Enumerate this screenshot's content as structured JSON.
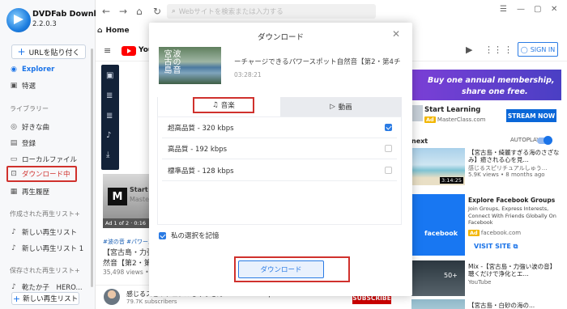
{
  "app": {
    "name": "DVDFab Downloader",
    "version": "2.2.0.3"
  },
  "sidebar": {
    "url_button": "URLを貼り付く",
    "items": [
      {
        "label": "Explorer",
        "icon": "compass-icon"
      },
      {
        "label": "特選",
        "icon": "star-icon"
      }
    ],
    "library_section": "ライブラリー",
    "library_items": [
      {
        "label": "好きな曲",
        "icon": "heart-icon"
      },
      {
        "label": "登録",
        "icon": "subscribe-icon"
      },
      {
        "label": "ローカルファイル",
        "icon": "folder-icon"
      },
      {
        "label": "ダウンロード中",
        "icon": "download-icon"
      },
      {
        "label": "再生履歴",
        "icon": "history-icon"
      }
    ],
    "created_section": "作成された再生リスト+",
    "created_items": [
      {
        "label": "新しい再生リスト"
      },
      {
        "label": "新しい再生リスト 1"
      }
    ],
    "saved_section": "保存された再生リスト+",
    "saved_items": [
      {
        "label": "乾たか子　HERO..."
      }
    ],
    "new_playlist": "新しい再生リスト"
  },
  "topbar": {
    "search_placeholder": "Webサイトを検索または入力する"
  },
  "home_tab": "Home",
  "youtube": {
    "logo_text": "YouTube",
    "sign_in": "SIGN IN"
  },
  "left_video": {
    "ad_title": "Start Le",
    "ad_sub": "MasterCl",
    "ad_line": "Ad 1 of 2 · 0:16",
    "tags": "#波の音 #パワースポ",
    "title_line1": "【宮古島・力強",
    "title_line2": "然音【第2・第",
    "views": "35,498 views • Aug"
  },
  "bottom_channel": {
    "name": "感じるスピリチュアルしゅうさんShusan Feel Spiritual",
    "subs": "79.7K subscribers",
    "subscribe": "SUBSCRIBE"
  },
  "right_column": {
    "banner_line1": "Buy one annual membership,",
    "banner_line2": "share one free.",
    "ad1_title": "Start Learning",
    "ad_badge": "Ad",
    "ad1_source": "MasterClass.com",
    "stream_button": "STREAM NOW",
    "next_label": "next",
    "autoplay": "AUTOPLAY",
    "v1_title": "【宮古島・綺麗すぎる海のさざなみ】癒される心を見...",
    "v1_channel": "感じるスピリチュアルしゅう...",
    "v1_meta": "5.9K views • 8 months ago",
    "v1_duration": "3:14:25",
    "ad2_title": "Explore Facebook Groups",
    "ad2_desc": "Join Groups, Express Interests, Connect With Friends Globally On Facebook",
    "ad2_source": "facebook.com",
    "ad2_thumb": "facebook",
    "visit_site": "VISIT SITE",
    "v2_title": "Mix -【宮古島・力強い波の音】聴くだけで浄化とエ...",
    "v2_channel": "YouTube",
    "v2_overlay": "50+",
    "v3_title": "【宮古島・白砂の海の..."
  },
  "modal": {
    "title": "ダウンロード",
    "video_title": "ーチャージできるパワースポット自然音【第2・第4チ",
    "video_date": "03:28:21",
    "thumb_text": "波の音 宮古島",
    "tab_music": "音楽",
    "tab_video": "動画",
    "qualities": [
      {
        "label": "超高品質 - 320 kbps",
        "checked": true
      },
      {
        "label": "高品質 - 192 kbps",
        "checked": false
      },
      {
        "label": "標準品質 - 128 kbps",
        "checked": false
      }
    ],
    "remember": "私の選択を記憶",
    "download_button": "ダウンロード"
  }
}
